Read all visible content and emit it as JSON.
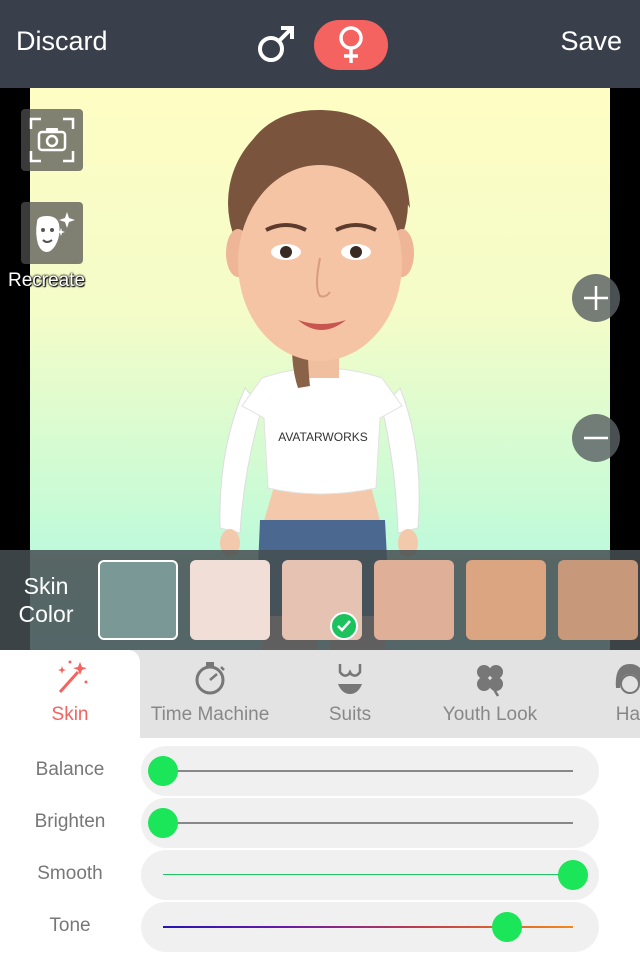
{
  "topbar": {
    "discard_label": "Discard",
    "save_label": "Save",
    "male_icon": "male-symbol-icon",
    "female_icon": "female-symbol-icon",
    "selected_gender": "female",
    "accent_color": "#f4635f"
  },
  "canvas": {
    "recreate_label": "Recreate",
    "shirt_text": "AVATARWORKS"
  },
  "skin_color": {
    "label_line1": "Skin",
    "label_line2": "Color",
    "selected_index": 2,
    "swatches": [
      "#7a9896",
      "#f1dfd7",
      "#e6c2b2",
      "#e0af97",
      "#dca582",
      "#c7987a"
    ]
  },
  "tabs": [
    {
      "label": "Skin",
      "icon": "magic-wand-icon",
      "active": true
    },
    {
      "label": "Time Machine",
      "icon": "stopwatch-icon",
      "active": false
    },
    {
      "label": "Suits",
      "icon": "bikini-icon",
      "active": false
    },
    {
      "label": "Youth Look",
      "icon": "clover-icon",
      "active": false
    },
    {
      "label": "Hai",
      "icon": "hair-icon",
      "active": false
    }
  ],
  "sliders": [
    {
      "label": "Balance",
      "value": 0.0
    },
    {
      "label": "Brighten",
      "value": 0.0
    },
    {
      "label": "Smooth",
      "value": 1.0
    },
    {
      "label": "Tone",
      "value": 0.84
    }
  ]
}
